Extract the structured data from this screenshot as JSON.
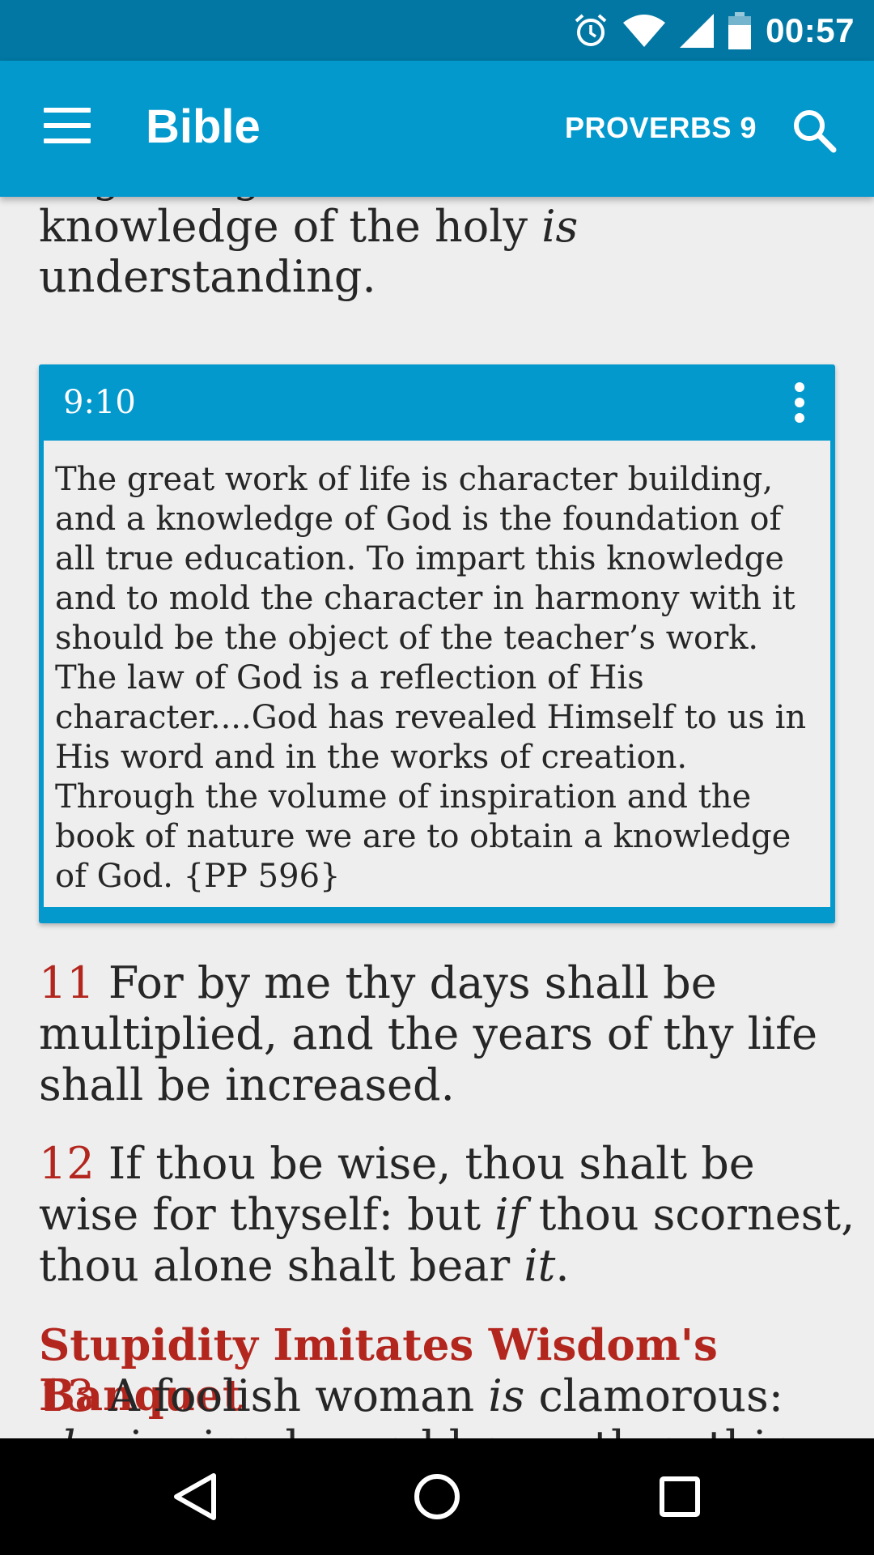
{
  "status_bar": {
    "time": "00:57",
    "icons": [
      "alarm-icon",
      "wifi-icon",
      "cell-signal-icon",
      "battery-icon"
    ]
  },
  "app_bar": {
    "title": "Bible",
    "chapter": "PROVERBS 9",
    "menu_icon": "hamburger-menu-icon",
    "search_icon": "search-icon"
  },
  "content": {
    "top_fragment": {
      "line1": "beginning of wisdom: and the",
      "line2_pre": "knowledge of the holy ",
      "line2_italic": "is",
      "line3": "understanding."
    },
    "comment": {
      "ref": "9:10",
      "text": "The great work of life is character building, and a knowledge of God is the foundation of all true education. To impart this knowledge and to mold the character in harmony with it should be the object of the teacher’s work. The law of God is a reflection of His character....God has revealed Himself to us in His word and in the works of creation. Through the volume of inspiration and the book of nature we are to obtain a knowledge of God. {PP 596}"
    },
    "verse11": {
      "num": "11",
      "text": " For by me thy days shall be multiplied, and the years of thy life shall be increased."
    },
    "verse12": {
      "num": "12",
      "t1": " If thou be wise, thou shalt be wise for thyself: but ",
      "i1": "if",
      "t2": " thou scornest, thou alone shalt bear ",
      "i2": "it",
      "t3": "."
    },
    "heading": "Stupidity Imitates Wisdom's Banquet",
    "verse13": {
      "num": "13",
      "t1": " A foolish woman ",
      "i1": "is",
      "t2": " clamorous: ",
      "i2": "she",
      "t3": " is simple, and knoweth nothing."
    }
  },
  "colors": {
    "status_bar": "#0277a3",
    "app_bar": "#0399cd",
    "verse_number": "#b3261e",
    "background": "#eeeeee"
  },
  "nav_bar": {
    "icons": [
      "back-icon",
      "home-icon",
      "recents-icon"
    ]
  }
}
